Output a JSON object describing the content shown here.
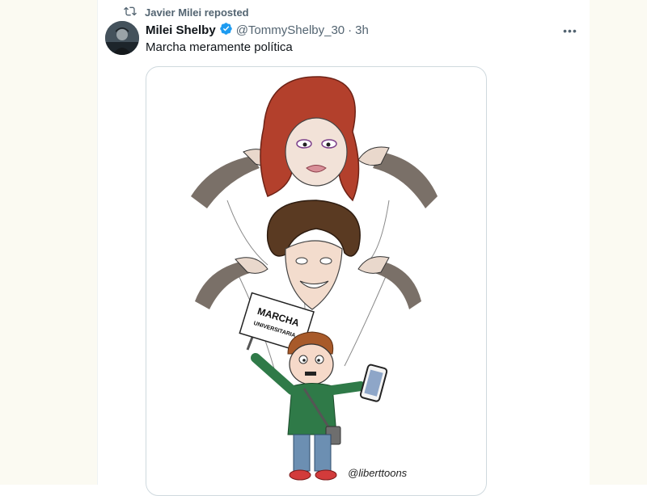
{
  "repost": {
    "label": "Javier Milei reposted",
    "icon": "repost-icon"
  },
  "tweet": {
    "display_name": "Milei Shelby",
    "verified": true,
    "handle": "@TommyShelby_30",
    "separator": "·",
    "time": "3h",
    "text": "Marcha meramente política",
    "more_label": "•••"
  },
  "media": {
    "sign_line1": "MARCHA",
    "sign_line2": "UNIVERSITARIA",
    "credit": "@liberttoons"
  },
  "colors": {
    "accent": "#1d9bf0",
    "secondary_text": "#536471",
    "border": "#cfd9de"
  }
}
